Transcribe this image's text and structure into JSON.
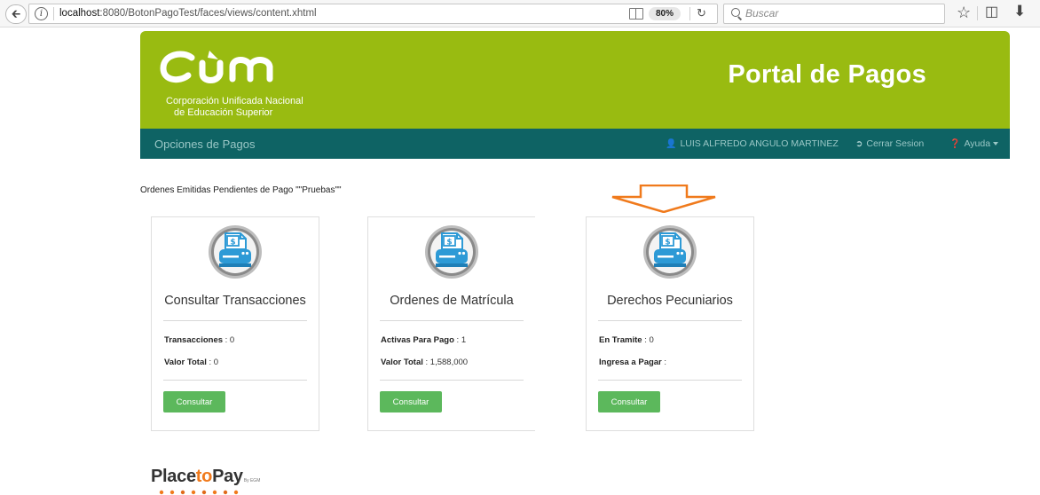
{
  "browser": {
    "url_host": "localhost",
    "url_path": ":8080/BotonPagoTest/faces/views/content.xhtml",
    "zoom": "80%",
    "search_placeholder": "Buscar"
  },
  "header": {
    "logo_line1": "Corporación Unificada Nacional",
    "logo_line2": "de Educación Superior",
    "title": "Portal de Pagos"
  },
  "navbar": {
    "brand": "Opciones de Pagos",
    "user": "LUIS ALFREDO ANGULO MARTINEZ",
    "logout": "Cerrar Sesion",
    "help": "Ayuda"
  },
  "page": {
    "heading": "Ordenes Emitidas Pendientes de Pago \"\"Pruebas\"\""
  },
  "cards": [
    {
      "title": "Consultar Transacciones",
      "stat1_label": "Transacciones",
      "stat1_value": " : 0",
      "stat2_label": "Valor Total",
      "stat2_value": " : 0",
      "button": "Consultar"
    },
    {
      "title": "Ordenes de Matrícula",
      "stat1_label": "Activas Para Pago",
      "stat1_value": " : 1",
      "stat2_label": "Valor Total",
      "stat2_value": " : 1,588,000",
      "button": "Consultar"
    },
    {
      "title": "Derechos Pecuniarios",
      "stat1_label": "En Tramite",
      "stat1_value": " : 0",
      "stat2_label": "Ingresa a Pagar",
      "stat2_value": " :",
      "button": "Consultar"
    }
  ],
  "footer": {
    "logo_place": "Place",
    "logo_to": "to",
    "logo_pay": "Pay",
    "logo_small": "By EGM"
  },
  "colors": {
    "header_green": "#99bb11",
    "navbar_teal": "#0e6364",
    "button_green": "#5cb85c",
    "arrow_orange": "#f07a1c",
    "icon_blue": "#2d9ad6"
  },
  "icons": {
    "card_icon": "payment-printer-icon",
    "arrow": "down-arrow-icon"
  }
}
